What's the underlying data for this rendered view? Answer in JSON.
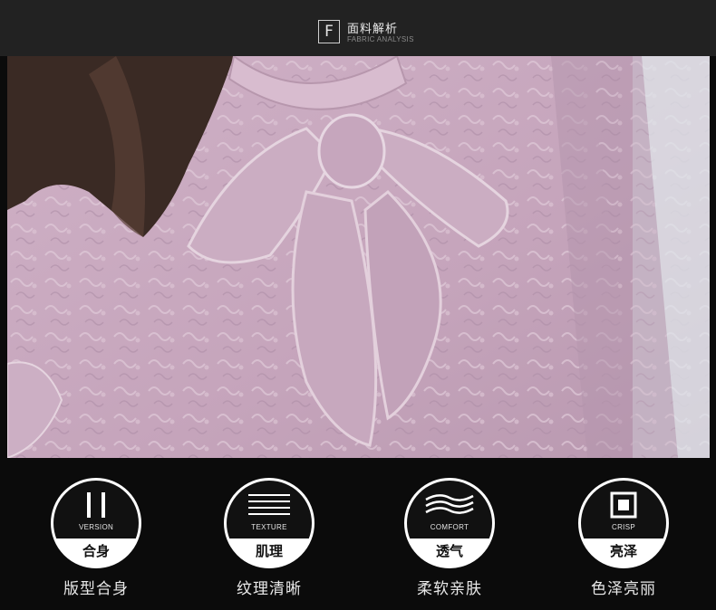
{
  "header": {
    "badge_letter": "F",
    "title": "面料解析",
    "subtitle": "FABRIC ANALYSIS"
  },
  "photo": {
    "subject": "blouse-fabric-closeup-icon",
    "colors": {
      "fabric": "#c9a9c0",
      "shadow": "#a88aa2",
      "hair": "#3a2a24",
      "window": "#dfe6ea"
    }
  },
  "features": [
    {
      "icon": "version-bars-icon",
      "en": "VERSION",
      "cn": "合身",
      "caption": "版型合身"
    },
    {
      "icon": "texture-lines-icon",
      "en": "TEXTURE",
      "cn": "肌理",
      "caption": "纹理清晰"
    },
    {
      "icon": "comfort-waves-icon",
      "en": "COMFORT",
      "cn": "透气",
      "caption": "柔软亲肤"
    },
    {
      "icon": "crisp-square-icon",
      "en": "CRISP",
      "cn": "亮泽",
      "caption": "色泽亮丽"
    }
  ]
}
